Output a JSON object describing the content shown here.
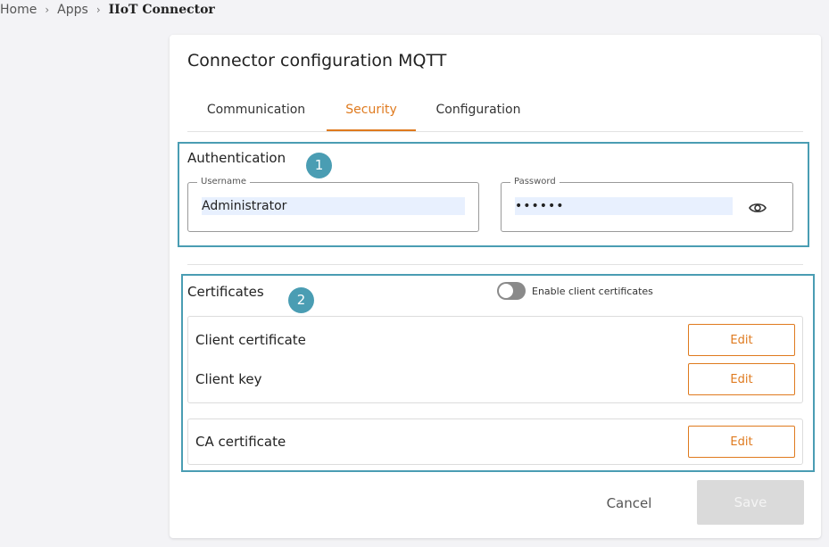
{
  "breadcrumb": {
    "home": "Home",
    "apps": "Apps",
    "current": "IIoT Connector",
    "separator": "›"
  },
  "page": {
    "title": "Connector configuration MQTT"
  },
  "tabs": [
    {
      "label": "Communication",
      "active": false
    },
    {
      "label": "Security",
      "active": true
    },
    {
      "label": "Configuration",
      "active": false
    }
  ],
  "markers": {
    "one": "1",
    "two": "2"
  },
  "authentication": {
    "title": "Authentication",
    "username_label": "Username",
    "username_value": "Administrator",
    "password_label": "Password",
    "password_value": "••••••",
    "reveal_icon": "eye-icon"
  },
  "certificates": {
    "title": "Certificates",
    "toggle_label": "Enable client certificates",
    "toggle_on": false,
    "rows": [
      {
        "label": "Client certificate",
        "action": "Edit"
      },
      {
        "label": "Client key",
        "action": "Edit"
      },
      {
        "label": "CA certificate",
        "action": "Edit"
      }
    ]
  },
  "actions": {
    "cancel": "Cancel",
    "save": "Save"
  },
  "colors": {
    "accent": "#df7a1e",
    "highlight": "#4a9db3",
    "disabled": "#dadada"
  }
}
